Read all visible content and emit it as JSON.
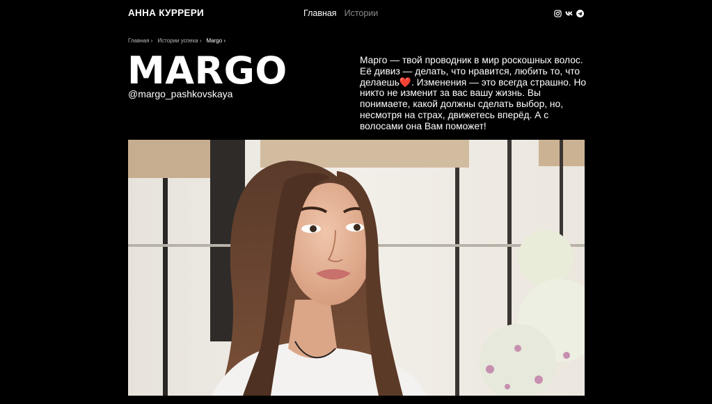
{
  "header": {
    "brand": "АННА КУРРЕРИ",
    "nav": [
      {
        "label": "Главная",
        "active": true
      },
      {
        "label": "Истории",
        "active": false
      }
    ],
    "social": [
      {
        "icon": "instagram-icon"
      },
      {
        "icon": "vk-icon"
      },
      {
        "icon": "telegram-icon"
      }
    ]
  },
  "breadcrumb": [
    {
      "label": "Главная"
    },
    {
      "label": "Истории успеха"
    },
    {
      "label": "Margo"
    }
  ],
  "profile": {
    "name": "MARGO",
    "handle": "@margo_pashkovskaya",
    "description_before": "Марго — твой проводник в мир роскошных волос. Её дивиз — делать, что нравится, любить то, что делаешь",
    "heart": "❤️",
    "description_after": ". Изменения — это всегда страшно. Но никто не изменит за вас вашу жизнь. Вы понимаете, какой должны сделать выбор, но, несмотря на страх, движетесь вперёд. А с волосами она Вам поможет!"
  },
  "colors": {
    "background": "#000000",
    "text": "#ffffff",
    "nav_inactive": "#8a8a8a",
    "heart": "#e0263a"
  }
}
